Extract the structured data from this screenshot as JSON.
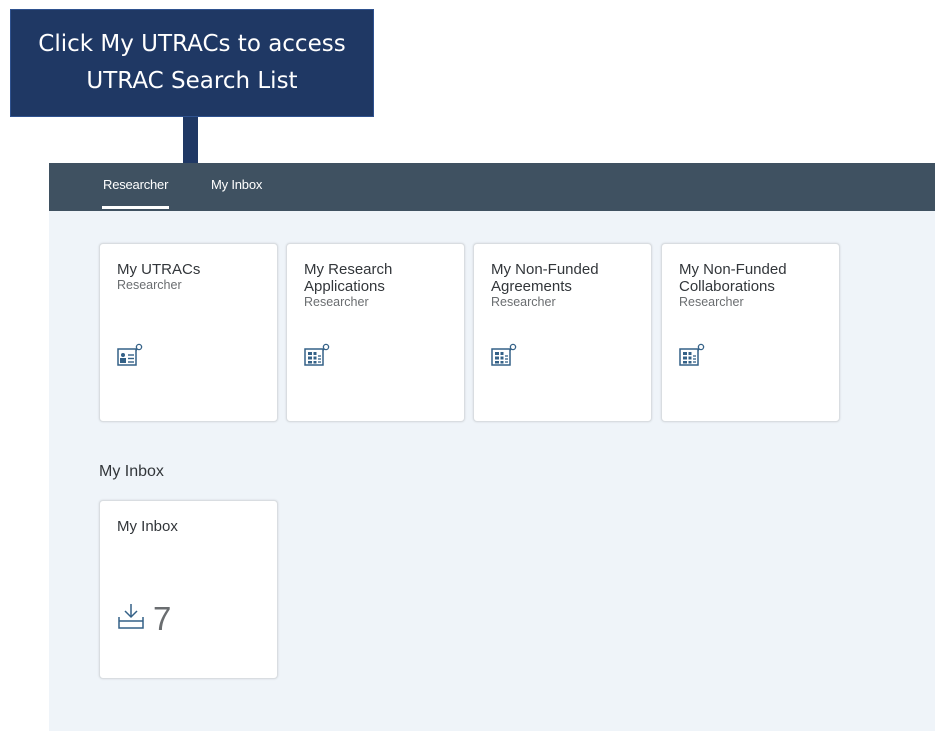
{
  "callout": {
    "line1": "Click My UTRACs to access",
    "line2": "UTRAC Search List"
  },
  "nav": {
    "tabs": [
      {
        "label": "Researcher",
        "active": true
      },
      {
        "label": "My Inbox",
        "active": false
      }
    ]
  },
  "tiles": [
    {
      "title": "My UTRACs",
      "subtitle": "Researcher",
      "icon": "id-card-search-icon"
    },
    {
      "title": "My Research Applications",
      "subtitle": "Researcher",
      "icon": "table-search-icon"
    },
    {
      "title": "My Non-Funded Agreements",
      "subtitle": "Researcher",
      "icon": "table-search-icon"
    },
    {
      "title": "My Non-Funded Collaborations",
      "subtitle": "Researcher",
      "icon": "table-search-icon"
    }
  ],
  "inbox_section": {
    "title": "My Inbox",
    "tile": {
      "title": "My Inbox",
      "count": "7",
      "icon": "inbox-download-icon"
    }
  },
  "colors": {
    "callout_bg": "#1f3864",
    "shellbar_bg": "#3f5161",
    "app_bg": "#eff4f9",
    "icon_color": "#346187"
  }
}
